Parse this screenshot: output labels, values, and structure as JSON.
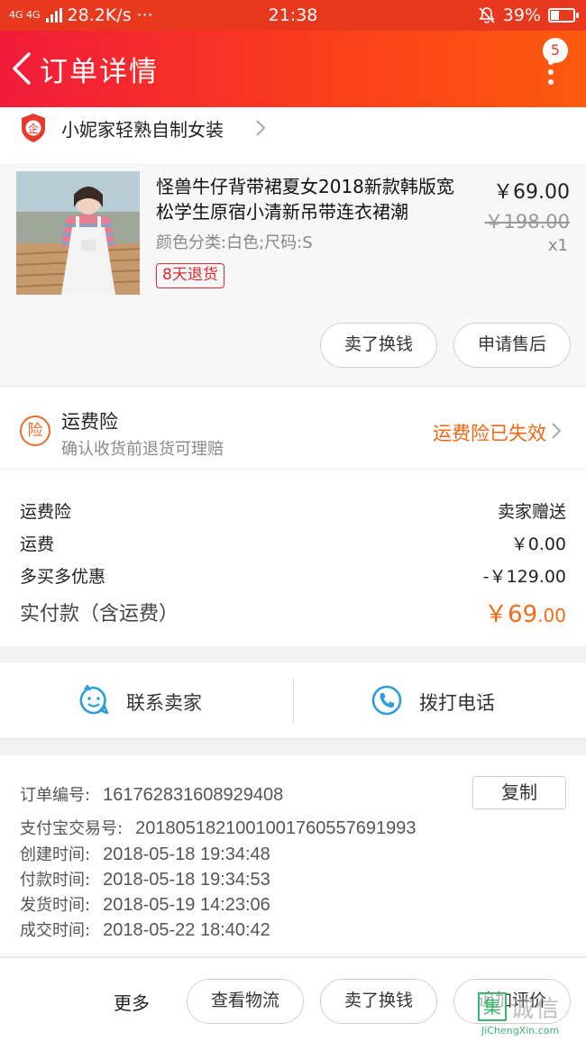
{
  "status_bar": {
    "network": "4G 4G",
    "speed": "28.2K/s",
    "dots": "···",
    "time": "21:38",
    "battery": "39%",
    "battery_level": 0.39
  },
  "nav": {
    "title": "订单详情",
    "badge_count": "5"
  },
  "shop": {
    "icon_text": "企",
    "name": "小妮家轻熟自制女装"
  },
  "product": {
    "title": "怪兽牛仔背带裙夏女2018新款韩版宽松学生原宿小清新吊带连衣裙潮",
    "spec": "颜色分类:白色;尺码:S",
    "tag": "8天退货",
    "price": "￥69.00",
    "original_price": "￥198.00",
    "quantity": "x1",
    "buttons": {
      "sell": "卖了换钱",
      "after_sale": "申请售后"
    }
  },
  "insurance": {
    "icon_text": "险",
    "title": "运费险",
    "subtitle": "确认收货前退货可理赔",
    "status": "运费险已失效"
  },
  "fees": {
    "rows": [
      {
        "label": "运费险",
        "value": "卖家赠送"
      },
      {
        "label": "运费",
        "value": "￥0.00"
      },
      {
        "label": "多买多优惠",
        "value": "-￥129.00"
      }
    ],
    "total_label": "实付款（含运费）",
    "total_int": "￥69",
    "total_dec": ".00"
  },
  "contact": {
    "seller": "联系卖家",
    "call": "拨打电话"
  },
  "order_info": {
    "order_no": {
      "label": "订单编号:",
      "value": "161762831608929408"
    },
    "copy": "复制",
    "alipay_no": {
      "label": "支付宝交易号:",
      "value": "2018051821001001760557691993"
    },
    "created": {
      "label": "创建时间:",
      "value": "2018-05-18 19:34:48"
    },
    "paid": {
      "label": "付款时间:",
      "value": "2018-05-18 19:34:53"
    },
    "shipped": {
      "label": "发货时间:",
      "value": "2018-05-19 14:23:06"
    },
    "completed": {
      "label": "成交时间:",
      "value": "2018-05-22 18:40:42"
    }
  },
  "bottom_bar": {
    "more": "更多",
    "logistics": "查看物流",
    "sell": "卖了换钱",
    "review": "追加评价"
  },
  "watermark": {
    "logo": "集",
    "cn": "诚信",
    "en": "JiChengXin.com"
  },
  "colors": {
    "brand_red": "#e8381e",
    "accent_orange": "#f26b14",
    "tag_red": "#e0272b",
    "contact_blue": "#2e9cde"
  }
}
